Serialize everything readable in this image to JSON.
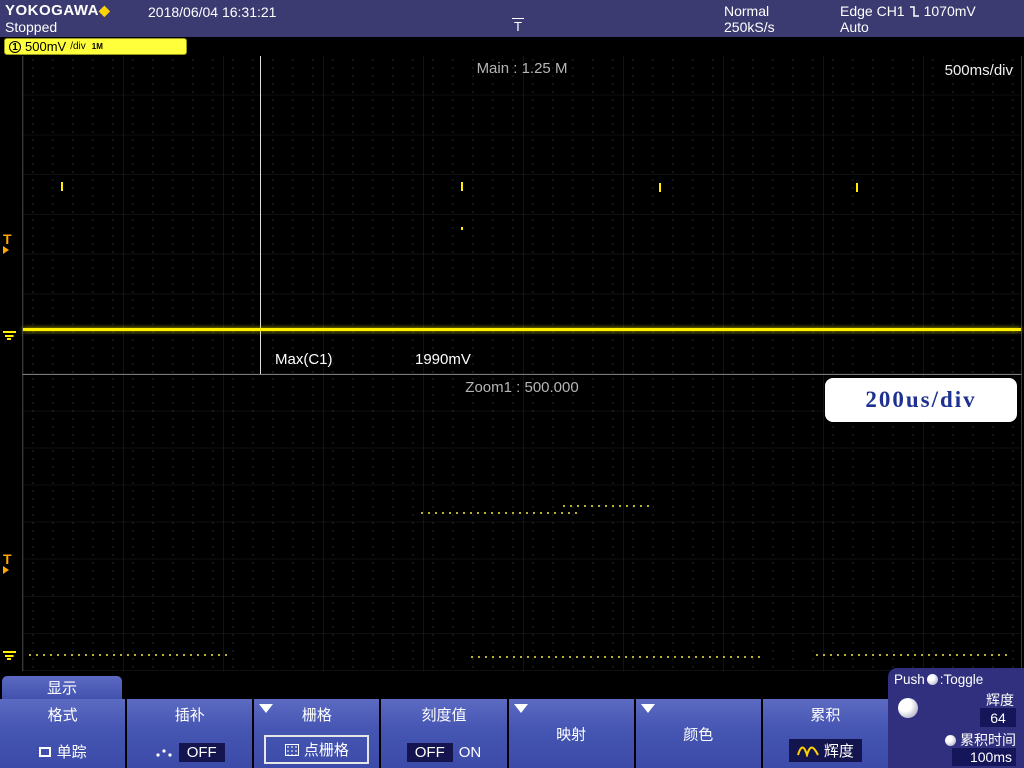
{
  "header": {
    "brand": "YOKOGAWA",
    "datetime": "2018/06/04 16:31:21",
    "status": "Stopped",
    "acq_mode": "Normal",
    "sample_rate": "250kS/s",
    "trigger_type": "Edge CH1",
    "trigger_level": "1070mV",
    "trigger_mode": "Auto"
  },
  "channel": {
    "number": "1",
    "scale": "500mV",
    "per_div": "/div",
    "coupling": "1M"
  },
  "main": {
    "record_label": "Main : 1.25 M",
    "timebase": "500ms/div",
    "measure_label": "Max(C1)",
    "measure_value": "1990mV"
  },
  "zoom": {
    "label": "Zoom1 : 500.000",
    "timebase": "200us/div"
  },
  "menu": {
    "tab": "显示",
    "format": {
      "title": "格式",
      "sub": "单踪"
    },
    "interp": {
      "title": "插补",
      "sub": "OFF"
    },
    "grid": {
      "title": "栅格",
      "sub": "点栅格"
    },
    "scale_value": {
      "title": "刻度值",
      "off": "OFF",
      "on": "ON"
    },
    "mapping": {
      "title": "映射"
    },
    "color": {
      "title": "颜色"
    },
    "accumulate": {
      "title": "累积",
      "sub": "辉度"
    }
  },
  "panel": {
    "push": "Push",
    "toggle": ":Toggle",
    "intensity_label": "辉度",
    "intensity_value": "64",
    "accum_time_label": "累积时间",
    "accum_time_value": "100ms"
  }
}
